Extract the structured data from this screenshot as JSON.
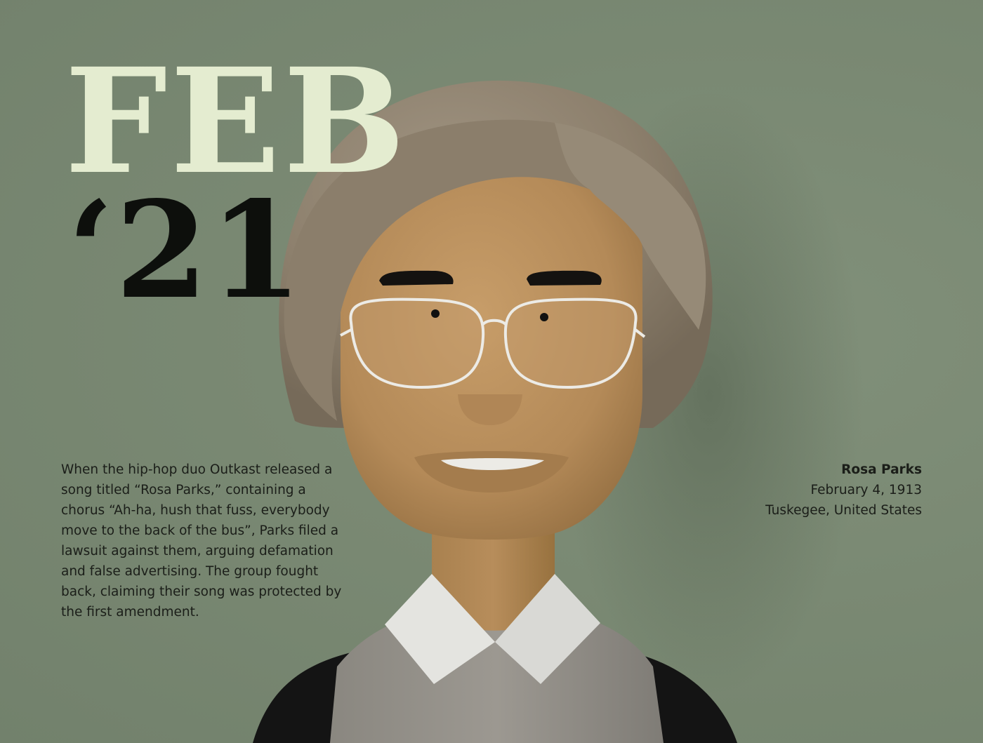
{
  "header": {
    "month": "FEB",
    "year": "‘21"
  },
  "story": {
    "text": "When the hip-hop duo Outkast released a song titled “Rosa Parks,” containing a chorus “Ah-ha, hush that fuss, everybody move to the back of the bus”, Parks filed a lawsuit against them, arguing defamation and false advertising. The group fought back, claiming their song was protected by the first amendment."
  },
  "caption": {
    "name": "Rosa Parks",
    "birth_date": "February 4, 1913",
    "birth_place": "Tuskegee, United States"
  },
  "colors": {
    "background": "#7b8a74",
    "month_text": "#e4ecd0",
    "year_text": "#0d0f0c",
    "skin": "#b98e5c",
    "hair": "#8f8271",
    "collar": "#e6e6e2"
  },
  "illustration": "3d-portrait-woman-glasses-grey-hair"
}
